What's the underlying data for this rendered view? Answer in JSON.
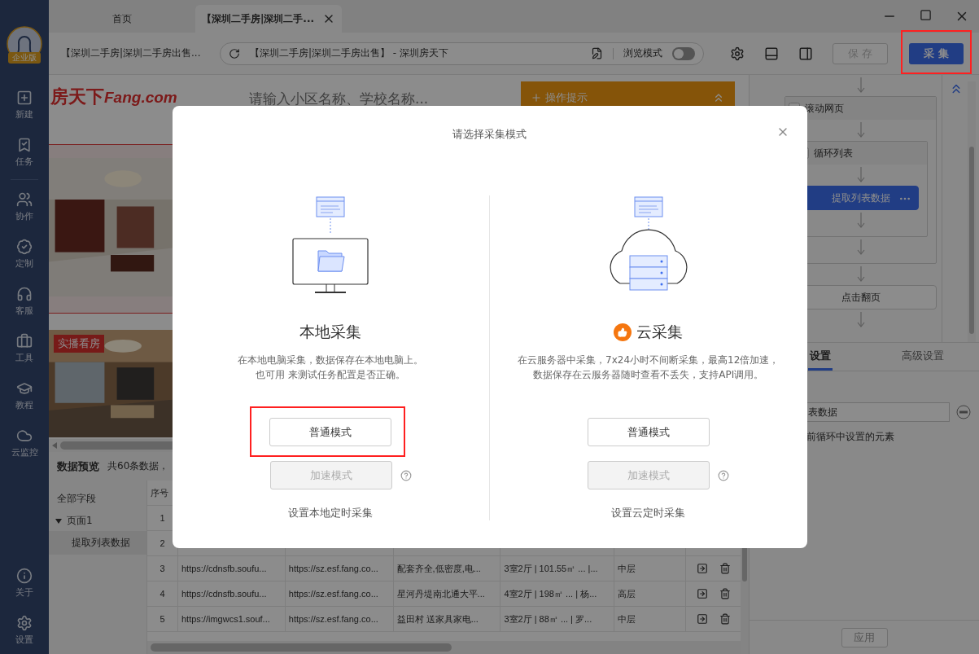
{
  "tabs": [
    {
      "label": "首页",
      "selected": false
    },
    {
      "label": "【深圳二手房|深圳二手...",
      "selected": true
    }
  ],
  "toolbar": {
    "page_title": "【深圳二手房|深圳二手房出售...",
    "address": "【深圳二手房|深圳二手房出售】 - 深圳房天下",
    "browse_mode": {
      "label": "浏览模式",
      "on": false
    },
    "save": {
      "label": "保 存",
      "disabled": true
    },
    "collect": {
      "label": "采 集",
      "highlighted": true
    }
  },
  "sidebar": {
    "badge": "企业版",
    "primary": [
      "新建",
      "任务"
    ],
    "secondary": [
      "协作",
      "定制",
      "客服",
      "工具",
      "教程",
      "云监控"
    ],
    "bottom": [
      "关于",
      "设置"
    ]
  },
  "webpage": {
    "logo": "房天下",
    "logo_latin": "Fang.com",
    "search_placeholder": "请输入小区名称、学校名称...",
    "tip": "操作提示",
    "live_tag": "实播看房"
  },
  "preview": {
    "title": "数据预览",
    "count": "共60条数据，",
    "tree": {
      "label": "全部字段",
      "children": [
        {
          "label": "页面1",
          "expanded": true,
          "children": [
            {
              "label": "提取列表数据",
              "selected": true
            }
          ]
        }
      ]
    },
    "columns": [
      "序号"
    ],
    "rows": [
      {
        "cells": [
          "1"
        ]
      },
      {
        "cells": [
          "2"
        ]
      },
      {
        "cells": [
          "3",
          "https://cdnsfb.soufu...",
          "https://sz.esf.fang.co...",
          "配套齐全,低密度,电...",
          "3室2厅 | 101.55㎡ ... |...",
          "中层"
        ]
      },
      {
        "cells": [
          "4",
          "https://cdnsfb.soufu...",
          "https://sz.esf.fang.co...",
          "星河丹堤南北通大平...",
          "4室2厅 | 198㎡ ... | 杨...",
          "高层"
        ]
      },
      {
        "cells": [
          "5",
          "https://imgwcs1.souf...",
          "https://sz.esf.fang.co...",
          "益田村 送家具家电...",
          "3室2厅 | 88㎡ ... | 罗...",
          "中层"
        ]
      }
    ]
  },
  "flow": [
    {
      "kind": "group",
      "label": "滚动网页",
      "children": [
        {
          "kind": "group",
          "label": "循环列表",
          "children": [
            {
              "kind": "step",
              "label": "提取列表数据",
              "selected": true
            }
          ]
        }
      ]
    },
    {
      "kind": "step",
      "label": "点击翻页",
      "selected": false
    }
  ],
  "settings": {
    "tabs": [
      {
        "label": "设置",
        "selected": true
      },
      {
        "label": "高级设置",
        "selected": false
      }
    ],
    "name_value": "表数据",
    "hint": "前循环中设置的元素",
    "apply": "应用"
  },
  "dialog": {
    "title": "请选择采集模式",
    "options": [
      {
        "kind": "local",
        "title": "本地采集",
        "recommended": false,
        "description": [
          "在本地电脑采集，数据保存在本地电脑上。",
          "也可用 来测试任务配置是否正确。"
        ],
        "normal": "普通模式",
        "normal_highlighted": true,
        "fast": "加速模式",
        "fast_disabled": true,
        "schedule": "设置本地定时采集"
      },
      {
        "kind": "cloud",
        "title": "云采集",
        "recommended": true,
        "description": [
          "在云服务器中采集，7x24小时不间断采集，最高12倍加速，",
          "数据保存在云服务器随时查看不丢失，支持API调用。"
        ],
        "normal": "普通模式",
        "normal_highlighted": false,
        "fast": "加速模式",
        "fast_disabled": true,
        "schedule": "设置云定时采集"
      }
    ]
  }
}
